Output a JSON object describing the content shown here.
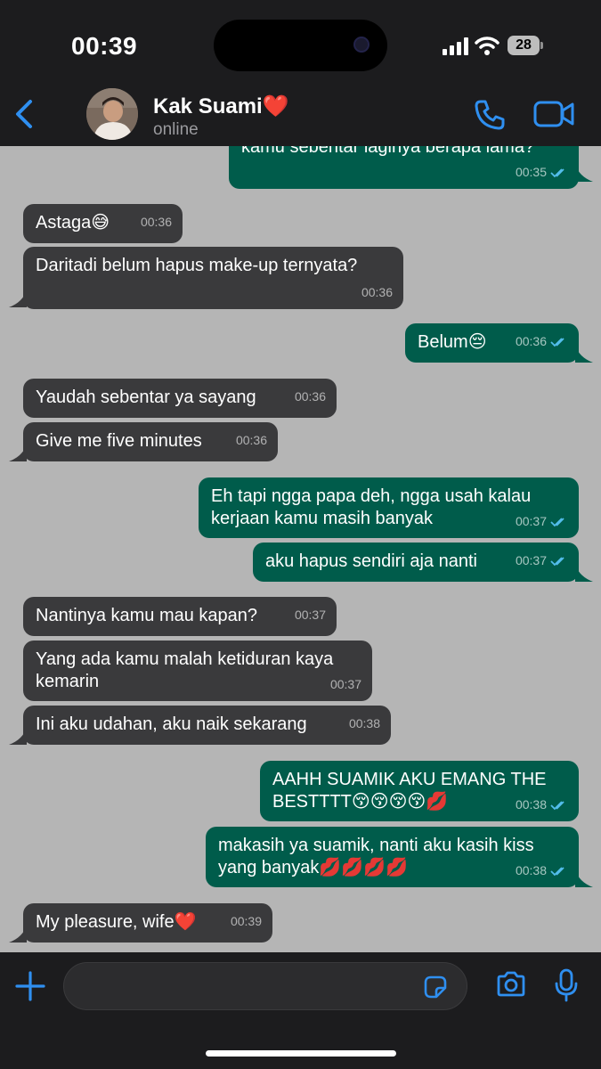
{
  "status_bar": {
    "time": "00:39",
    "battery": "28"
  },
  "header": {
    "back_icon": "chevron-left-icon",
    "contact_name": "Kak Suami❤️",
    "status": "online",
    "call_icon": "phone-icon",
    "video_icon": "video-camera-icon"
  },
  "colors": {
    "accent": "#2f8ff0",
    "incoming": "#3a3a3c",
    "outgoing": "#005c4b",
    "chat_bg": "#b5b5b5"
  },
  "messages": [
    {
      "dir": "out",
      "text": "kamu sebentar laginya berapa lama?",
      "time": "00:35",
      "read": true
    },
    {
      "dir": "in",
      "text": "Astaga😅",
      "time": "00:36"
    },
    {
      "dir": "in",
      "text": "Daritadi belum hapus make-up ternyata?",
      "time": "00:36"
    },
    {
      "dir": "out",
      "text": "Belum😔",
      "time": "00:36",
      "read": true
    },
    {
      "dir": "in",
      "text": "Yaudah sebentar ya sayang",
      "time": "00:36"
    },
    {
      "dir": "in",
      "text": "Give me five minutes",
      "time": "00:36"
    },
    {
      "dir": "out",
      "text": "Eh tapi ngga papa deh, ngga usah kalau\nkerjaan kamu masih banyak",
      "time": "00:37",
      "read": true
    },
    {
      "dir": "out",
      "text": "aku hapus sendiri aja nanti",
      "time": "00:37",
      "read": true
    },
    {
      "dir": "in",
      "text": "Nantinya kamu mau kapan?",
      "time": "00:37"
    },
    {
      "dir": "in",
      "text": "Yang ada kamu malah ketiduran kaya\nkemarin",
      "time": "00:37"
    },
    {
      "dir": "in",
      "text": "Ini aku udahan, aku naik sekarang",
      "time": "00:38"
    },
    {
      "dir": "out",
      "text": "AAHH SUAMIK AKU EMANG THE\nBESTTTT😚😚😚😚💋",
      "time": "00:38",
      "read": true
    },
    {
      "dir": "out",
      "text": "makasih ya suamik, nanti aku kasih kiss\nyang banyak💋💋💋💋",
      "time": "00:38",
      "read": true
    },
    {
      "dir": "in",
      "text": "My pleasure, wife❤️",
      "time": "00:39"
    }
  ],
  "composer": {
    "placeholder": "",
    "plus_icon": "plus-icon",
    "sticker_icon": "sticker-icon",
    "camera_icon": "camera-icon",
    "mic_icon": "microphone-icon"
  }
}
